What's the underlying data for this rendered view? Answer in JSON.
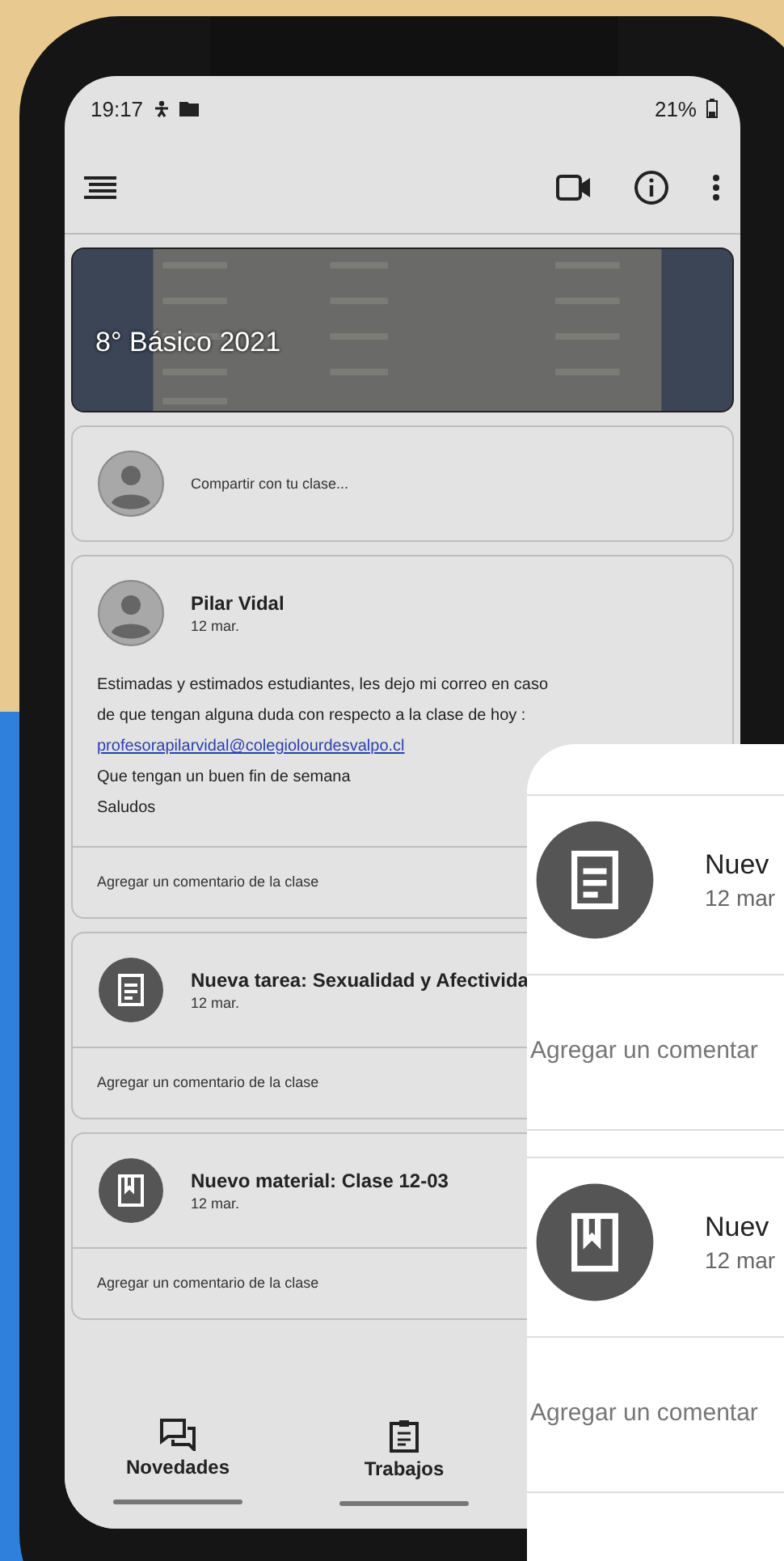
{
  "status_bar": {
    "time": "19:17",
    "battery": "21%"
  },
  "class_banner": {
    "title": "8° Básico 2021"
  },
  "share_box": {
    "placeholder": "Compartir con tu clase..."
  },
  "posts": [
    {
      "kind": "announcement",
      "author": "Pilar Vidal",
      "date": "12 mar.",
      "body": [
        {
          "kind": "text",
          "text": "Estimadas y estimados estudiantes, les dejo mi correo en caso"
        },
        {
          "kind": "text",
          "text": "de que tengan alguna duda con respecto a la clase de hoy :"
        },
        {
          "kind": "link",
          "text": "profesorapilarvidal@colegiolourdesvalpo.cl"
        },
        {
          "kind": "text",
          "text": "Que tengan un buen fin de semana"
        },
        {
          "kind": "text",
          "text": "Saludos"
        }
      ],
      "comment_prompt": "Agregar un comentario de la clase"
    },
    {
      "kind": "assignment",
      "title": "Nueva tarea: Sexualidad y Afectivida",
      "date": "12 mar.",
      "comment_prompt": "Agregar un comentario de la clase"
    },
    {
      "kind": "material",
      "title": "Nuevo material: Clase 12-03",
      "date": "12 mar.",
      "comment_prompt": "Agregar un comentario de la clase"
    }
  ],
  "bottom_nav": [
    {
      "kind": "stream",
      "label": "Novedades"
    },
    {
      "kind": "classwork",
      "label": "Trabajos"
    }
  ],
  "zoom_inset": {
    "items": [
      {
        "kind": "assignment",
        "title": "Nuev",
        "date": "12 mar",
        "comment_prompt": "Agregar un comentar"
      },
      {
        "kind": "material",
        "title": "Nuev",
        "date": "12 mar",
        "comment_prompt": "Agregar un comentar"
      }
    ]
  }
}
